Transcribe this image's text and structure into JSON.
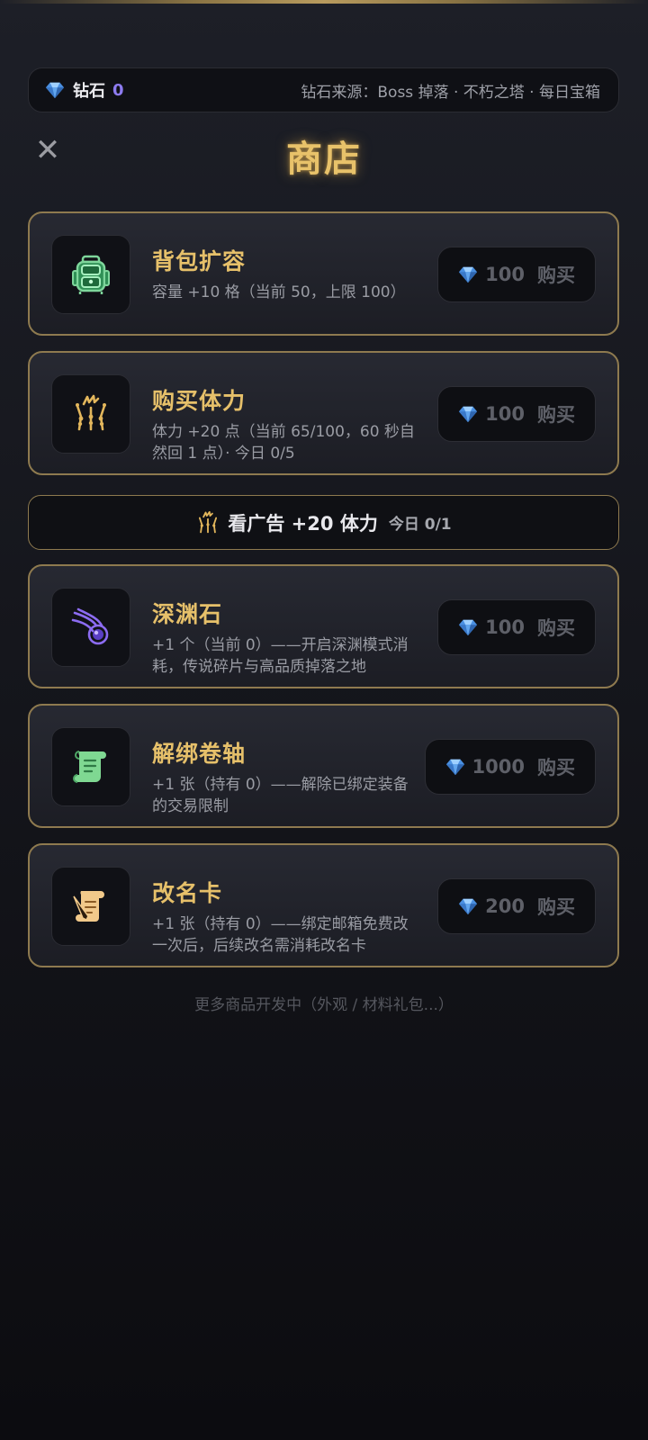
{
  "colors": {
    "accent_gold": "#e6c06a",
    "card_border": "#8e7a4f",
    "diamond_count": "#8d7bf0",
    "gem_blue": "#5aa8f0"
  },
  "diamond_bar": {
    "icon": "diamond-icon",
    "label": "钻石",
    "count": "0",
    "source": "钻石来源：Boss 掉落 · 不朽之塔 · 每日宝箱"
  },
  "header": {
    "close_icon": "close-icon",
    "close_label": "✕",
    "title": "商店"
  },
  "items": [
    {
      "icon": "backpack-icon",
      "title": "背包扩容",
      "desc": "容量 +10 格（当前 50，上限 100）",
      "price": "100",
      "buy_label": "购买"
    },
    {
      "icon": "stamina-icon",
      "title": "购买体力",
      "desc": "体力 +20 点（当前 65/100，60 秒自然回 1 点）· 今日 0/5",
      "price": "100",
      "buy_label": "购买"
    },
    {
      "icon": "abyss-flame-icon",
      "title": "深渊石",
      "desc": "+1 个（当前 0）——开启深渊模式消耗，传说碎片与高品质掉落之地",
      "price": "100",
      "buy_label": "购买"
    },
    {
      "icon": "scroll-icon",
      "title": "解绑卷轴",
      "desc": "+1 张（持有 0）——解除已绑定装备的交易限制",
      "price": "1000",
      "buy_label": "购买"
    },
    {
      "icon": "rename-card-icon",
      "title": "改名卡",
      "desc": "+1 张（持有 0）——绑定邮箱免费改一次后，后续改名需消耗改名卡",
      "price": "200",
      "buy_label": "购买"
    }
  ],
  "ad_bar": {
    "icon": "stamina-icon",
    "label": "看广告 +20 体力",
    "count": "今日 0/1"
  },
  "footer": {
    "note": "更多商品开发中（外观 / 材料礼包...）"
  }
}
